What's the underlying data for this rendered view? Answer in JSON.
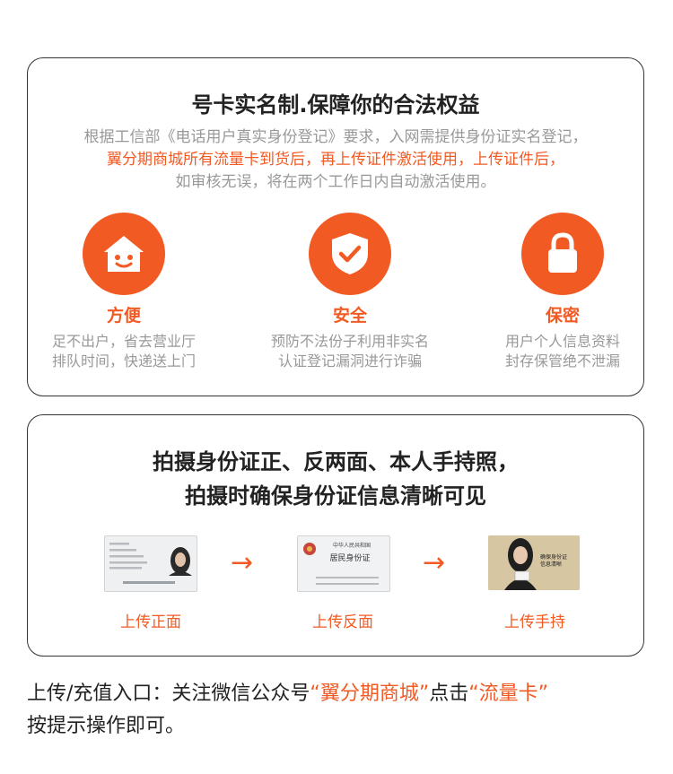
{
  "rights_card": {
    "title": "号卡实名制.保障你的合法权益",
    "desc_line1": "根据工信部《电话用户真实身份登记》要求，入网需提供身份证实名登记，",
    "desc_line2": "翼分期商城所有流量卡到货后，再上传证件激活使用，上传证件后，",
    "desc_line3": "如审核无误，将在两个工作日内自动激活使用。",
    "features": [
      {
        "icon": "house-icon",
        "title": "方便",
        "desc1": "足不出户，省去营业厅",
        "desc2": "排队时间，快递送上门"
      },
      {
        "icon": "shield-check-icon",
        "title": "安全",
        "desc1": "预防不法份子利用非实名",
        "desc2": "认证登记漏洞进行诈骗"
      },
      {
        "icon": "lock-icon",
        "title": "保密",
        "desc1": "用户个人信息资料",
        "desc2": "封存保管绝不泄漏"
      }
    ]
  },
  "photo_card": {
    "title_line1": "拍摄身份证正、反两面、本人手持照，",
    "title_line2": "拍摄时确保身份证信息清晰可见",
    "steps": [
      {
        "caption": "上传正面"
      },
      {
        "caption": "上传反面"
      },
      {
        "caption": "上传手持"
      }
    ],
    "id_back_text": {
      "country": "中华人民共和国",
      "card_name": "居民身份证"
    },
    "hold_note": {
      "line1": "确保身份证",
      "line2": "信息清晰"
    }
  },
  "footer": {
    "prefix": "上传/充值入口：关注微信公众号",
    "highlight1": "“翼分期商城”",
    "middle": "点击",
    "highlight2": "“流量卡”",
    "suffix": "按提示操作即可。"
  },
  "colors": {
    "accent": "#f25a24",
    "muted": "#999999",
    "text": "#222222"
  }
}
